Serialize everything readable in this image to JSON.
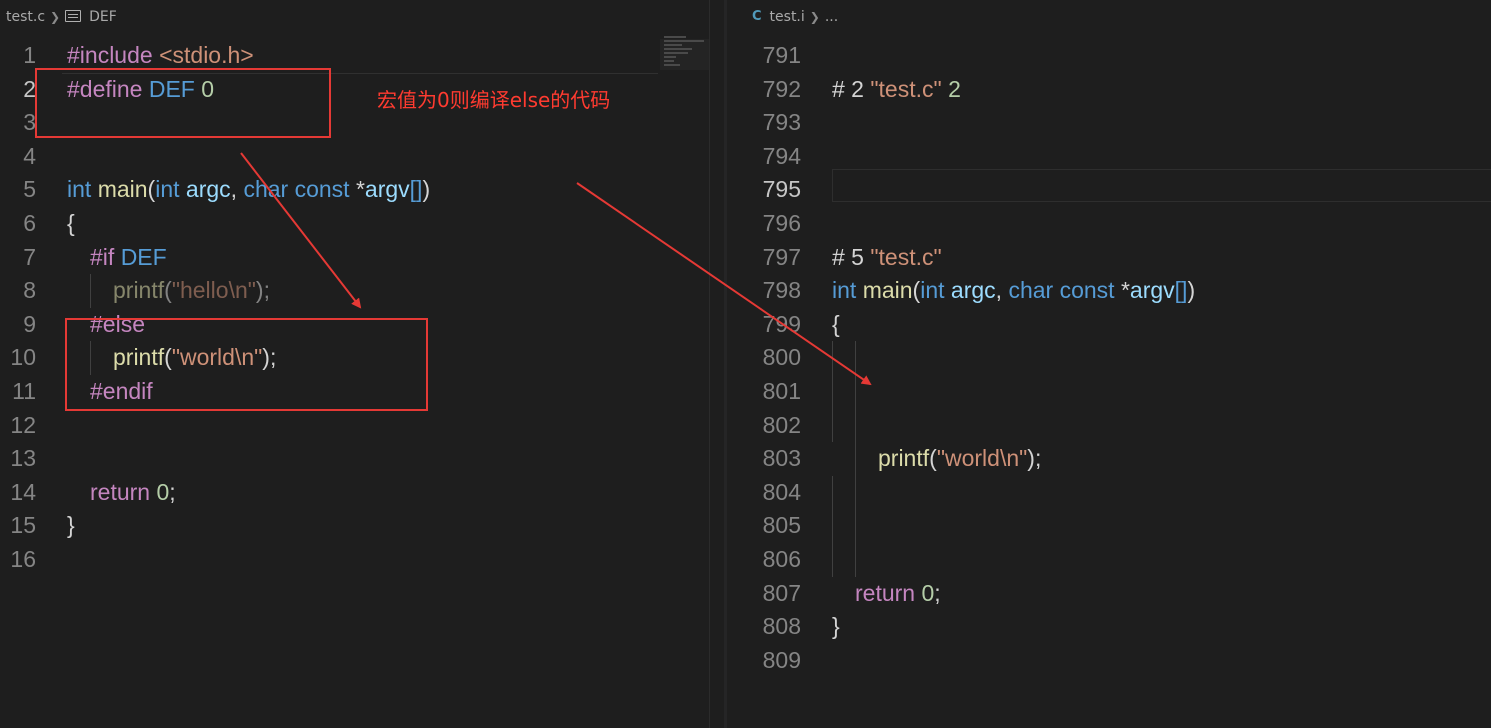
{
  "left_editor": {
    "breadcrumb": {
      "file": "test.c",
      "symbol": "DEF"
    },
    "lines": [
      {
        "n": "1",
        "tokens": [
          {
            "c": "dir",
            "t": "#include"
          },
          {
            "c": "plain",
            "t": " "
          },
          {
            "c": "str",
            "t": "<stdio.h>"
          }
        ]
      },
      {
        "n": "2",
        "active": true,
        "tokens": [
          {
            "c": "dir",
            "t": "#define"
          },
          {
            "c": "plain",
            "t": " "
          },
          {
            "c": "mac",
            "t": "DEF"
          },
          {
            "c": "plain",
            "t": " "
          },
          {
            "c": "num",
            "t": "0"
          }
        ]
      },
      {
        "n": "3",
        "tokens": []
      },
      {
        "n": "4",
        "tokens": []
      },
      {
        "n": "5",
        "tokens": [
          {
            "c": "type",
            "t": "int"
          },
          {
            "c": "plain",
            "t": " "
          },
          {
            "c": "fn",
            "t": "main"
          },
          {
            "c": "op",
            "t": "("
          },
          {
            "c": "type",
            "t": "int"
          },
          {
            "c": "plain",
            "t": " "
          },
          {
            "c": "var",
            "t": "argc"
          },
          {
            "c": "op",
            "t": ", "
          },
          {
            "c": "type",
            "t": "char"
          },
          {
            "c": "plain",
            "t": " "
          },
          {
            "c": "type",
            "t": "const"
          },
          {
            "c": "plain",
            "t": " "
          },
          {
            "c": "op",
            "t": "*"
          },
          {
            "c": "var",
            "t": "argv"
          },
          {
            "c": "br",
            "t": "[]"
          },
          {
            "c": "op",
            "t": ")"
          }
        ]
      },
      {
        "n": "6",
        "tokens": [
          {
            "c": "op",
            "t": "{"
          }
        ]
      },
      {
        "n": "7",
        "indent": 1,
        "tokens": [
          {
            "c": "dir",
            "t": "#if"
          },
          {
            "c": "plain",
            "t": " "
          },
          {
            "c": "mac",
            "t": "DEF"
          }
        ]
      },
      {
        "n": "8",
        "indent": 2,
        "inactive": true,
        "tokens": [
          {
            "c": "fn",
            "t": "printf"
          },
          {
            "c": "op",
            "t": "("
          },
          {
            "c": "str",
            "t": "\"hello\\n\""
          },
          {
            "c": "op",
            "t": ");"
          }
        ]
      },
      {
        "n": "9",
        "indent": 1,
        "tokens": [
          {
            "c": "dir",
            "t": "#else"
          }
        ]
      },
      {
        "n": "10",
        "indent": 2,
        "tokens": [
          {
            "c": "fn",
            "t": "printf"
          },
          {
            "c": "op",
            "t": "("
          },
          {
            "c": "str",
            "t": "\"world\\n\""
          },
          {
            "c": "op",
            "t": ");"
          }
        ]
      },
      {
        "n": "11",
        "indent": 1,
        "tokens": [
          {
            "c": "dir",
            "t": "#endif"
          }
        ]
      },
      {
        "n": "12",
        "tokens": []
      },
      {
        "n": "13",
        "tokens": []
      },
      {
        "n": "14",
        "indent": 1,
        "tokens": [
          {
            "c": "kw",
            "t": "return"
          },
          {
            "c": "plain",
            "t": " "
          },
          {
            "c": "num",
            "t": "0"
          },
          {
            "c": "op",
            "t": ";"
          }
        ]
      },
      {
        "n": "15",
        "tokens": [
          {
            "c": "op",
            "t": "}"
          }
        ]
      },
      {
        "n": "16",
        "tokens": []
      }
    ]
  },
  "right_editor": {
    "breadcrumb": {
      "file_icon": "C",
      "file": "test.i",
      "rest": "..."
    },
    "lines": [
      {
        "n": "791",
        "tokens": []
      },
      {
        "n": "792",
        "tokens": [
          {
            "c": "plain",
            "t": "# 2 "
          },
          {
            "c": "str",
            "t": "\"test.c\""
          },
          {
            "c": "plain",
            "t": " "
          },
          {
            "c": "num",
            "t": "2"
          }
        ]
      },
      {
        "n": "793",
        "tokens": []
      },
      {
        "n": "794",
        "tokens": []
      },
      {
        "n": "795",
        "active": true,
        "tokens": []
      },
      {
        "n": "796",
        "tokens": []
      },
      {
        "n": "797",
        "tokens": [
          {
            "c": "plain",
            "t": "# 5 "
          },
          {
            "c": "str",
            "t": "\"test.c\""
          }
        ]
      },
      {
        "n": "798",
        "tokens": [
          {
            "c": "type",
            "t": "int"
          },
          {
            "c": "plain",
            "t": " "
          },
          {
            "c": "fn",
            "t": "main"
          },
          {
            "c": "op",
            "t": "("
          },
          {
            "c": "type",
            "t": "int"
          },
          {
            "c": "plain",
            "t": " "
          },
          {
            "c": "var",
            "t": "argc"
          },
          {
            "c": "op",
            "t": ", "
          },
          {
            "c": "type",
            "t": "char"
          },
          {
            "c": "plain",
            "t": " "
          },
          {
            "c": "type",
            "t": "const"
          },
          {
            "c": "plain",
            "t": " "
          },
          {
            "c": "op",
            "t": "*"
          },
          {
            "c": "var",
            "t": "argv"
          },
          {
            "c": "br",
            "t": "[]"
          },
          {
            "c": "op",
            "t": ")"
          }
        ]
      },
      {
        "n": "799",
        "tokens": [
          {
            "c": "op",
            "t": "{"
          }
        ]
      },
      {
        "n": "800",
        "guide": 1,
        "tokens": []
      },
      {
        "n": "801",
        "guide": 1,
        "tokens": []
      },
      {
        "n": "802",
        "guide": 1,
        "tokens": []
      },
      {
        "n": "803",
        "indent": 2,
        "tokens": [
          {
            "c": "fn",
            "t": "printf"
          },
          {
            "c": "op",
            "t": "("
          },
          {
            "c": "str",
            "t": "\"world\\n\""
          },
          {
            "c": "op",
            "t": ");"
          }
        ]
      },
      {
        "n": "804",
        "guide": 1,
        "tokens": []
      },
      {
        "n": "805",
        "guide": 1,
        "tokens": []
      },
      {
        "n": "806",
        "guide": 1,
        "tokens": []
      },
      {
        "n": "807",
        "indent": 1,
        "tokens": [
          {
            "c": "kw",
            "t": "return"
          },
          {
            "c": "plain",
            "t": " "
          },
          {
            "c": "num",
            "t": "0"
          },
          {
            "c": "op",
            "t": ";"
          }
        ]
      },
      {
        "n": "808",
        "tokens": [
          {
            "c": "op",
            "t": "}"
          }
        ]
      },
      {
        "n": "809",
        "tokens": []
      }
    ]
  },
  "annotation": {
    "text": "宏值为0则编译else的代码",
    "color": "#ff3b30"
  },
  "theme": {
    "background": "#1e1e1e",
    "line_number": "#858585",
    "directive": "#c586c0",
    "string": "#ce9178",
    "keyword_blue": "#569cd6",
    "function": "#dcdcaa",
    "variable": "#9cdcfe",
    "number": "#b5cea8"
  }
}
